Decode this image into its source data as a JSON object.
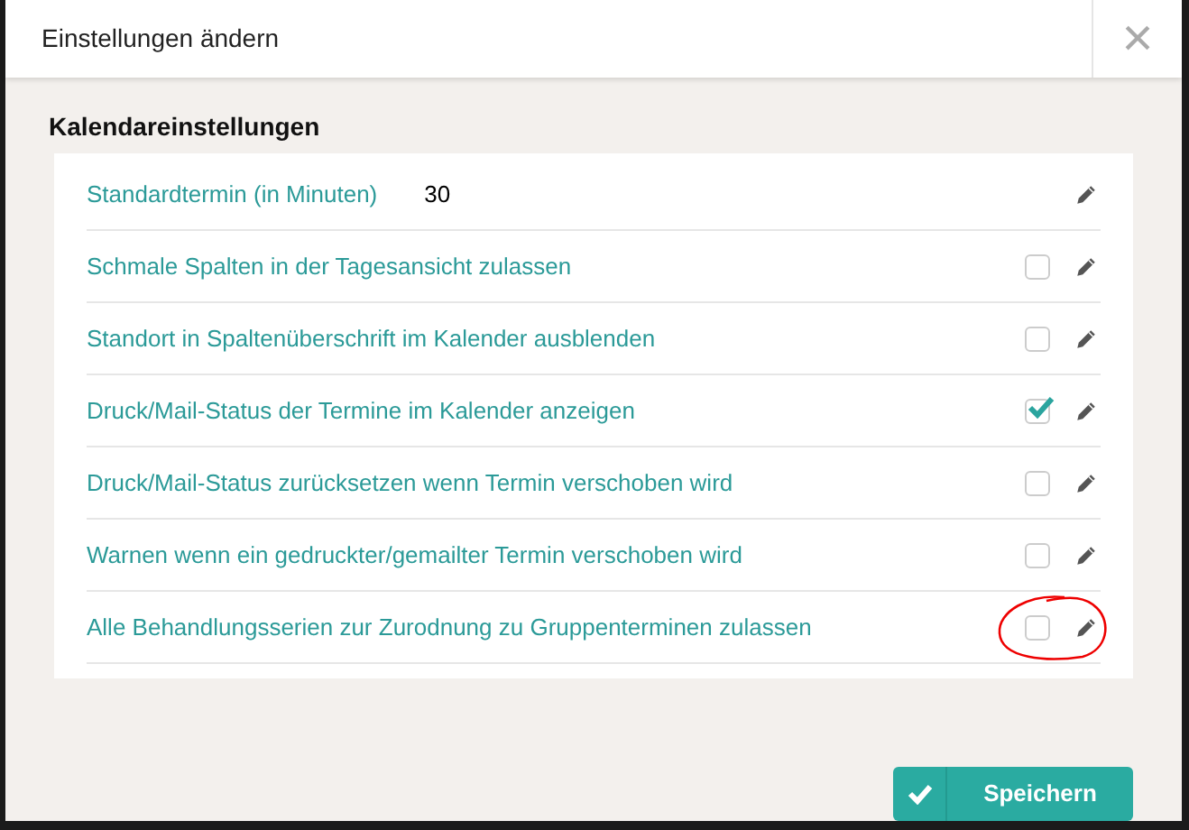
{
  "window": {
    "title": "Einstellungen ändern",
    "close": "×"
  },
  "section": {
    "title": "Kalendareinstellungen"
  },
  "rows": [
    {
      "kind": "value",
      "label": "Standardtermin (in Minuten)",
      "value": "30"
    },
    {
      "kind": "checkbox",
      "label": "Schmale Spalten in der Tagesansicht zulassen",
      "checked": false,
      "highlighted": false
    },
    {
      "kind": "checkbox",
      "label": "Standort in Spaltenüberschrift im Kalender ausblenden",
      "checked": false,
      "highlighted": false
    },
    {
      "kind": "checkbox",
      "label": "Druck/Mail-Status der Termine im Kalender anzeigen",
      "checked": true,
      "highlighted": false
    },
    {
      "kind": "checkbox",
      "label": "Druck/Mail-Status zurücksetzen wenn Termin verschoben wird",
      "checked": false,
      "highlighted": false
    },
    {
      "kind": "checkbox",
      "label": "Warnen wenn ein gedruckter/gemailter Termin verschoben wird",
      "checked": false,
      "highlighted": false
    },
    {
      "kind": "checkbox",
      "label": "Alle Behandlungsserien zur Zurodnung zu Gruppenterminen zulassen",
      "checked": false,
      "highlighted": true
    }
  ],
  "save_button": {
    "label": "Speichern"
  }
}
